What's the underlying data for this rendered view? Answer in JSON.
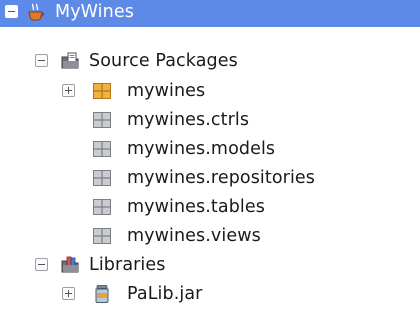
{
  "tree": {
    "project": {
      "label": "MyWines",
      "icon": "coffee-cup-project-icon",
      "expanded": true,
      "selected": true
    },
    "source_packages": {
      "label": "Source Packages",
      "icon": "source-packages-folder-icon",
      "expanded": true,
      "packages": [
        {
          "label": "mywines",
          "icon": "package-icon",
          "expandable": true
        },
        {
          "label": "mywines.ctrls",
          "icon": "empty-package-icon"
        },
        {
          "label": "mywines.models",
          "icon": "empty-package-icon"
        },
        {
          "label": "mywines.repositories",
          "icon": "empty-package-icon"
        },
        {
          "label": "mywines.tables",
          "icon": "empty-package-icon"
        },
        {
          "label": "mywines.views",
          "icon": "empty-package-icon"
        }
      ]
    },
    "libraries": {
      "label": "Libraries",
      "icon": "libraries-folder-icon",
      "expanded": true,
      "items": [
        {
          "label": "PaLib.jar",
          "icon": "jar-file-icon",
          "expandable": true
        }
      ]
    }
  },
  "colors": {
    "selection": "#5d8ae6",
    "text": "#1a1a1a",
    "package": "#f0b23c"
  }
}
